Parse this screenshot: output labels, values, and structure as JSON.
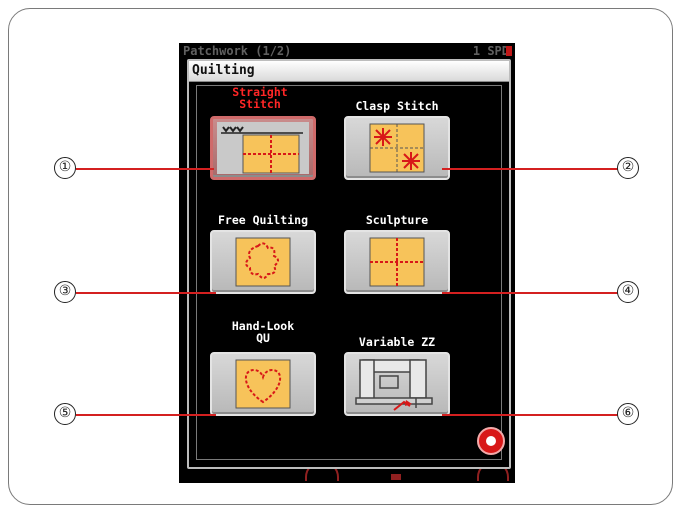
{
  "screen": {
    "status_left": "Patchwork (1/2)",
    "status_right": "1 SPD"
  },
  "dialog": {
    "title": "Quilting",
    "buttons": [
      {
        "label_line1": "Straight",
        "label_line2": "Stitch",
        "icon": "straight-stitch-icon",
        "selected": true
      },
      {
        "label_line1": "Clasp Stitch",
        "label_line2": "",
        "icon": "clasp-stitch-icon",
        "selected": false
      },
      {
        "label_line1": "Free Quilting",
        "label_line2": "",
        "icon": "free-quilting-icon",
        "selected": false
      },
      {
        "label_line1": "Sculpture",
        "label_line2": "",
        "icon": "sculpture-icon",
        "selected": false
      },
      {
        "label_line1": "Hand-Look",
        "label_line2": "QU",
        "icon": "hand-look-quilt-icon",
        "selected": false
      },
      {
        "label_line1": "Variable ZZ",
        "label_line2": "",
        "icon": "variable-zigzag-icon",
        "selected": false
      }
    ],
    "close_icon": "close-icon"
  },
  "callouts": [
    "①",
    "②",
    "③",
    "④",
    "⑤",
    "⑥"
  ],
  "colors": {
    "selected_label": "#ff2626",
    "leader_line": "#d42020",
    "close_button": "#d81818",
    "quilt_fill": "#f7c35a"
  }
}
